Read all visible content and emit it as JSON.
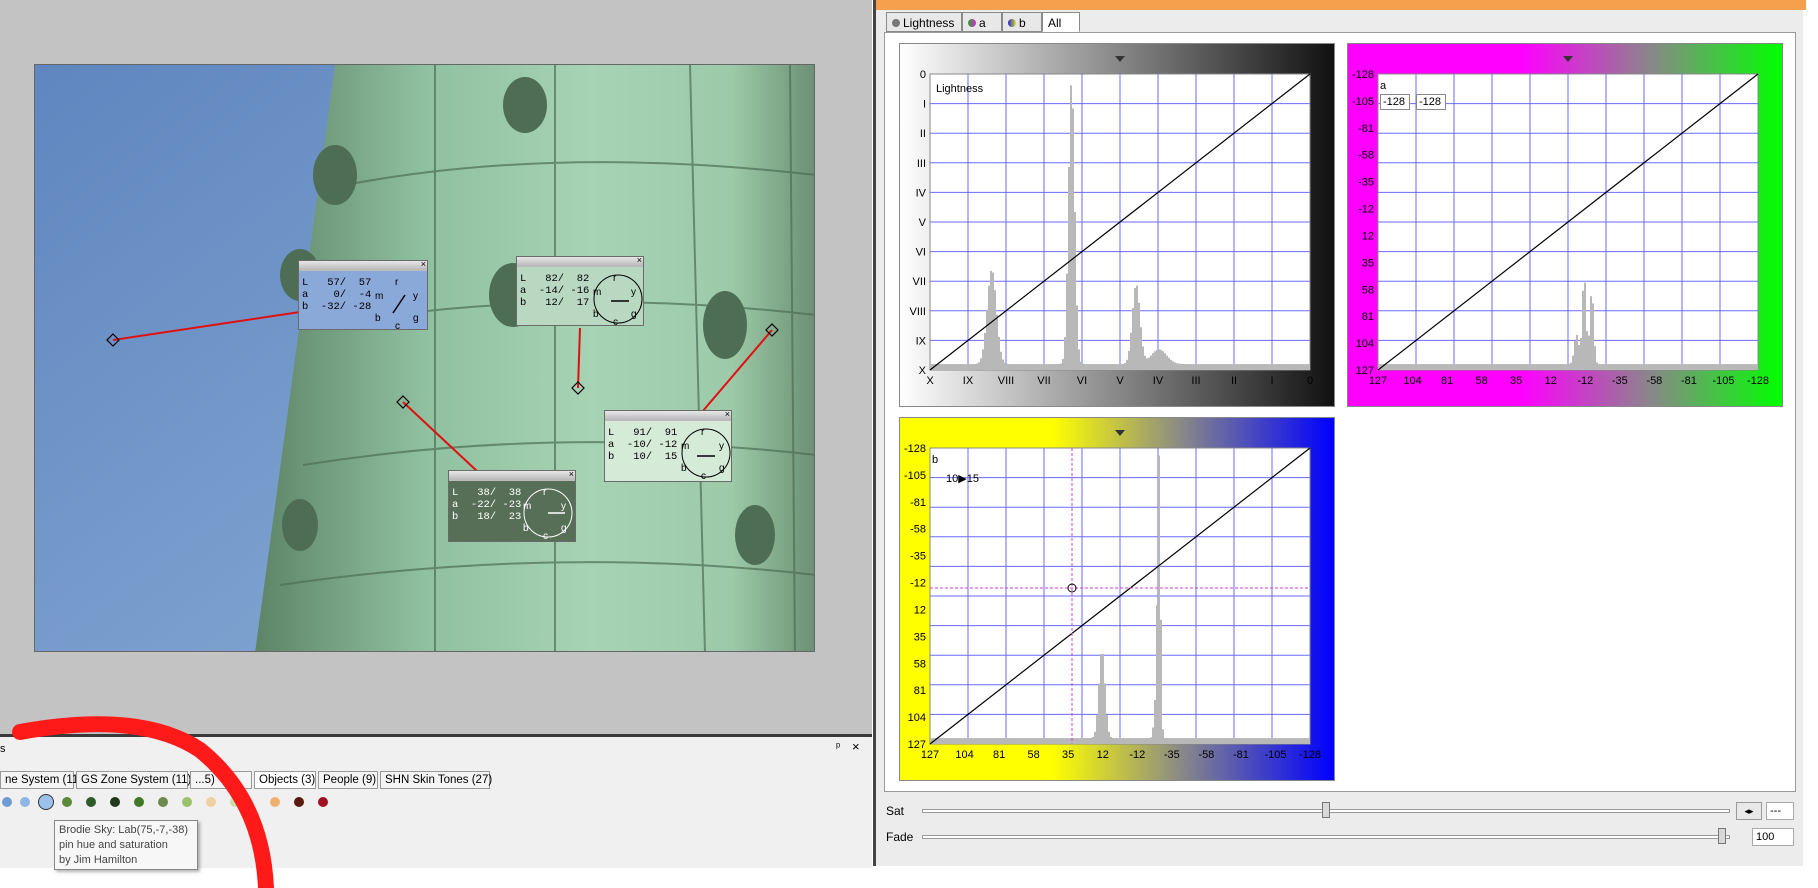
{
  "left_panel": {
    "samples": [
      {
        "id": "s1",
        "L": "L   57/  57",
        "a": "a    0/  -4",
        "b": "b  -32/ -28",
        "color": "#8aa8d8"
      },
      {
        "id": "s2",
        "L": "L   82/  82",
        "a": "a  -14/ -16",
        "b": "b   12/  17",
        "color": "#b9d8c2"
      },
      {
        "id": "s3",
        "L": "L   91/  91",
        "a": "a  -10/ -12",
        "b": "b   10/  15",
        "color": "#d6ead8"
      },
      {
        "id": "s4",
        "L": "L   38/  38",
        "a": "a  -22/ -23",
        "b": "b   18/  23",
        "color": "#566f56"
      }
    ],
    "dial_letters": {
      "m": "m",
      "r": "r",
      "y": "y",
      "g": "g",
      "c": "c",
      "b": "b"
    },
    "close_glyph": "×"
  },
  "pin_panel": {
    "title_fragment": "s",
    "pin_glyph": "ᵖ",
    "close_glyph": "×",
    "tabs": [
      "ne System (11)",
      "GS Zone System (11)",
      "...5)",
      "Objects (3)",
      "People (9)",
      "SHN Skin Tones (27)"
    ],
    "tooltip": {
      "line1": "Brodie Sky: Lab(75,-7,-38)",
      "line2": "pin hue and saturation",
      "line3": "by Jim Hamilton"
    }
  },
  "curves": {
    "tabs": [
      {
        "label": "Lightness",
        "icon": "lightness-icon"
      },
      {
        "label": "a",
        "icon": "a-channel-icon"
      },
      {
        "label": "b",
        "icon": "b-channel-icon"
      },
      {
        "label": "All",
        "icon": ""
      }
    ],
    "active_tab": "All",
    "lightness_panel": {
      "label": "Lightness",
      "y_ticks": [
        "0",
        "I",
        "II",
        "III",
        "IV",
        "V",
        "VI",
        "VII",
        "VIII",
        "IX",
        "X"
      ],
      "x_ticks": [
        "X",
        "IX",
        "VIII",
        "VII",
        "VI",
        "V",
        "IV",
        "III",
        "II",
        "I",
        "0"
      ]
    },
    "a_panel": {
      "label": "a",
      "input_value": "-128",
      "output_value": "-128",
      "y_ticks": [
        "-128",
        "-105",
        "-81",
        "-58",
        "-35",
        "-12",
        "12",
        "35",
        "58",
        "81",
        "104",
        "127"
      ],
      "x_ticks": [
        "127",
        "104",
        "81",
        "58",
        "35",
        "12",
        "-12",
        "-35",
        "-58",
        "-81",
        "-105",
        "-128"
      ]
    },
    "b_panel": {
      "label": "b",
      "readout": "10▶15",
      "y_ticks": [
        "-128",
        "-105",
        "-81",
        "-58",
        "-35",
        "-12",
        "12",
        "35",
        "58",
        "81",
        "104",
        "127"
      ],
      "x_ticks": [
        "127",
        "104",
        "81",
        "58",
        "35",
        "12",
        "-12",
        "-35",
        "-58",
        "-81",
        "-105",
        "-128"
      ]
    },
    "sat": {
      "label": "Sat",
      "value": "---",
      "level": 0.5
    },
    "fade": {
      "label": "Fade",
      "value": "100",
      "level": 1.0
    }
  },
  "colors": {
    "grid": "#6a6aff",
    "sample_line": "#e01010",
    "annotation": "#ff1a1a",
    "title_bar": "#f5a04c"
  }
}
